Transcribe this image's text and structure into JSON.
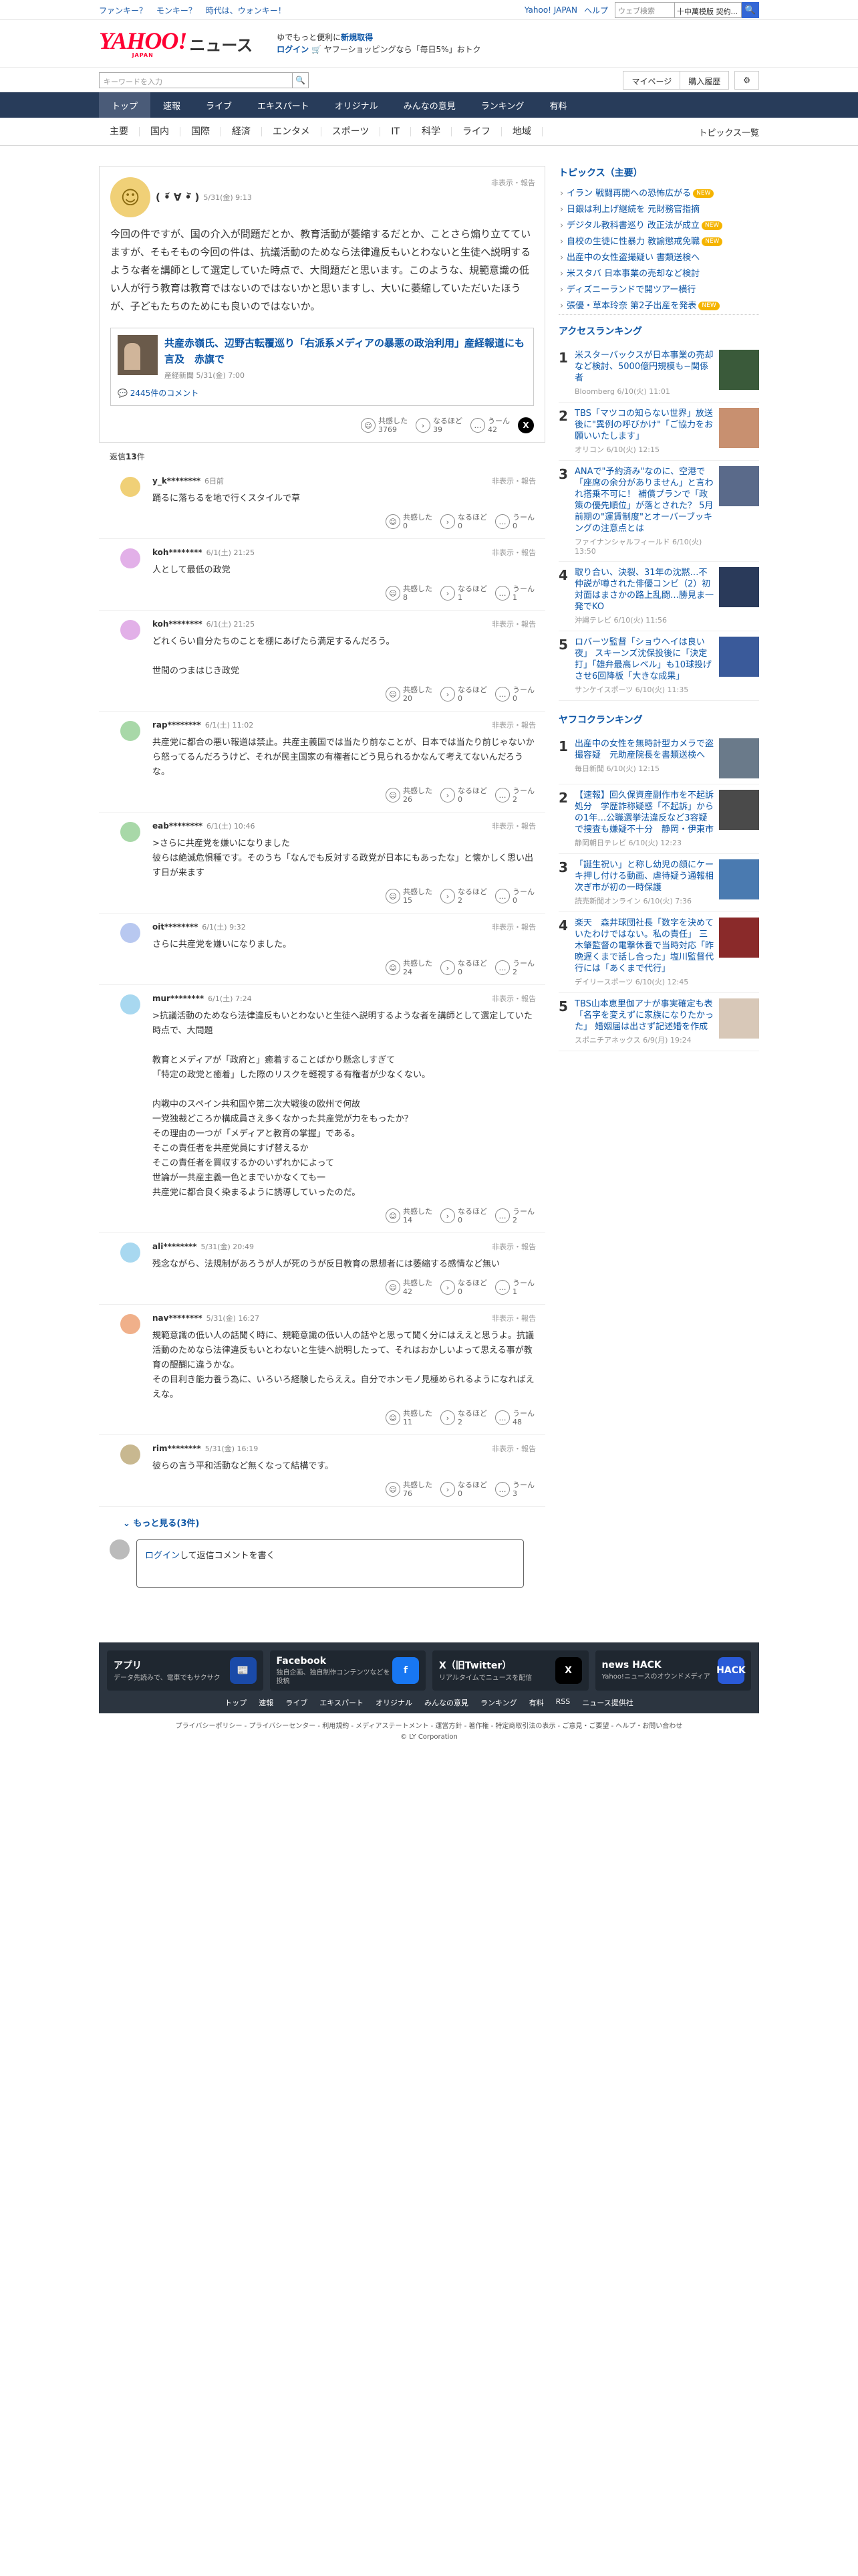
{
  "top": {
    "left_links": [
      "ファンキー？",
      "モンキー？",
      "時代は、ウォンキー！"
    ],
    "right_links": [
      "Yahoo! JAPAN",
      "ヘルプ"
    ],
    "search_placeholder": "ウェブ検索",
    "search_hot": "十中萬模版 契約...",
    "search_btn": "🔍"
  },
  "header": {
    "logo": "YAHOO!",
    "logo_sub": "JAPAN",
    "news": "ニュース",
    "promo_text": "ゆでもっと便利に",
    "promo_strong": "新規取得",
    "promo_login": "ログイン",
    "promo_rest": "🛒 ヤフーショッピングなら「毎日5%」おトク"
  },
  "subhead": {
    "kw_placeholder": "キーワードを入力",
    "kw_btn": "🔍",
    "mypage": "マイページ",
    "history": "購入履歴",
    "gear": "⚙"
  },
  "gnav": [
    "トップ",
    "速報",
    "ライブ",
    "エキスパート",
    "オリジナル",
    "みんなの意見",
    "ランキング",
    "有料"
  ],
  "cnav": [
    "主要",
    "国内",
    "国際",
    "経済",
    "エンタメ",
    "スポーツ",
    "IT",
    "科学",
    "ライフ",
    "地域"
  ],
  "cnav_right": "トピックス一覧",
  "post": {
    "name": "( •᷄ ∀ •᷅ )",
    "date": "5/31(金) 9:13",
    "hide": "非表示・報告",
    "text": "今回の件ですが、国の介入が問題だとか、教育活動が萎縮するだとか、ことさら煽り立てていますが、そもそもの今回の件は、抗議活動のためなら法律違反もいとわないと生徒へ説明するような者を講師として選定していた時点で、大問題だと思います。このような、規範意識の低い人が行う教育は教育ではないのではないかと思いますし、大いに萎縮していただいたほうが、子どもたちのためにも良いのではないか。",
    "link_title": "共産赤嶺氏、辺野古転覆巡り「右派系メディアの暴悪の政治利用」産経報道にも言及　赤旗で",
    "link_src": "産経新聞 5/31(金) 7:00",
    "comments": "2445件のコメント",
    "r1": "共感した",
    "r1n": "3769",
    "r2": "なるほど",
    "r2n": "39",
    "r3": "うーん",
    "r3n": "42",
    "x": "X"
  },
  "replies_label": "返信",
  "replies_count": "13",
  "replies_unit": "件",
  "replies": [
    {
      "user": "y_k********",
      "date": "6日前",
      "color": "#f0d077",
      "text": "踊るに落ちるを地で行くスタイルで草",
      "a": "0",
      "b": "0",
      "c": "0"
    },
    {
      "user": "koh********",
      "date": "6/1(土) 21:25",
      "color": "#e2b0e8",
      "text": "人として最低の政党",
      "a": "8",
      "b": "1",
      "c": "1"
    },
    {
      "user": "koh********",
      "date": "6/1(土) 21:25",
      "color": "#e2b0e8",
      "text": "どれくらい自分たちのことを棚にあげたら満足するんだろう。\n\n世間のつまはじき政党",
      "a": "20",
      "b": "0",
      "c": "0"
    },
    {
      "user": "rap********",
      "date": "6/1(土) 11:02",
      "color": "#a8d8a8",
      "text": "共産党に都合の悪い報道は禁止。共産主義国では当たり前なことが、日本では当たり前じゃないから怒ってるんだろうけど、それが民主国家の有権者にどう見られるかなんて考えてないんだろうな。",
      "a": "26",
      "b": "0",
      "c": "2"
    },
    {
      "user": "eab********",
      "date": "6/1(土) 10:46",
      "color": "#a8d8a8",
      "text": ">さらに共産党を嫌いになりました\n彼らは絶滅危惧種です。そのうち「なんでも反対する政党が日本にもあったな」と懐かしく思い出す日が来ます",
      "a": "15",
      "b": "2",
      "c": "0"
    },
    {
      "user": "oit********",
      "date": "6/1(土) 9:32",
      "color": "#b8c8f0",
      "text": "さらに共産党を嫌いになりました。",
      "a": "24",
      "b": "0",
      "c": "2"
    },
    {
      "user": "mur********",
      "date": "6/1(土) 7:24",
      "color": "#a8d8f0",
      "text": ">抗議活動のためなら法律違反もいとわないと生徒へ説明するような者を講師として選定していた時点で、大問題\n\n教育とメディアが「政府と」癒着することばかり懸念しすぎて\n「特定の政党と癒着」した際のリスクを軽視する有権者が少なくない。\n\n内戦中のスペイン共和国や第二次大戦後の欧州で何故\n一党独裁どころか構成員さえ多くなかった共産党が力をもったか？\nその理由の一つが「メディアと教育の掌握」である。\nそこの責任者を共産党員にすげ替えるか\nそこの責任者を買収するかのいずれかによって\n世論が一共産主義一色とまでいかなくても一\n共産党に都合良く染まるように誘導していったのだ。",
      "a": "14",
      "b": "0",
      "c": "2"
    },
    {
      "user": "ali********",
      "date": "5/31(金) 20:49",
      "color": "#a8d8f0",
      "text": "残念ながら、法規制があろうが人が死のうが反日教育の思想者には萎縮する感情など無い",
      "a": "42",
      "b": "0",
      "c": "1"
    },
    {
      "user": "nav********",
      "date": "5/31(金) 16:27",
      "color": "#f0b08a",
      "text": "規範意識の低い人の話聞く時に、規範意識の低い人の話やと思って聞く分にはええと思うよ。抗議活動のためなら法律違反もいとわないと生徒へ説明したって、それはおかしいよって思える事が教育の醍醐に違うかな。\nその目利き能力養う為に、いろいろ経験したらええ。自分でホンモノ見極められるようになればええな。",
      "a": "11",
      "b": "2",
      "c": "48"
    },
    {
      "user": "rim********",
      "date": "5/31(金) 16:19",
      "color": "#c8b890",
      "text": "彼らの言う平和活動など無くなって結構です。",
      "a": "76",
      "b": "0",
      "c": "3"
    }
  ],
  "labels": {
    "r1": "共感した",
    "r2": "なるほど",
    "r3": "うーん",
    "hide": "非表示・報告"
  },
  "more": "もっと見る(3件)",
  "form": {
    "login": "ログイン",
    "rest": "して返信コメントを書く"
  },
  "topics": {
    "title": "トピックス（主要）",
    "items": [
      {
        "t": "イラン 戦闘再開への恐怖広がる",
        "badge": "new"
      },
      {
        "t": "日銀は利上げ継続を 元財務官指摘",
        "badge": ""
      },
      {
        "t": "デジタル教科書巡り 改正法が成立",
        "badge": "new"
      },
      {
        "t": "自校の生徒に性暴力 教諭懲戒免職",
        "badge": "new"
      },
      {
        "t": "出産中の女性盗撮疑い 書類送検へ",
        "badge": ""
      },
      {
        "t": "米スタバ 日本事業の売却など検討",
        "badge": ""
      },
      {
        "t": "ディズニーランドで開ツアー横行",
        "badge": ""
      },
      {
        "t": "張優・草本玲奈 第2子出産を発表",
        "badge": "new"
      }
    ]
  },
  "access": {
    "title": "アクセスランキング",
    "items": [
      {
        "no": "1",
        "t": "米スターバックスが日本事業の売却など検討、5000億円規模も−関係者",
        "s": "Bloomberg 6/10(火) 11:01",
        "c": "#3a5a3a"
      },
      {
        "no": "2",
        "t": "TBS「マツコの知らない世界」放送後に\"異例の呼びかけ\"「ご協力をお願いいたします」",
        "s": "オリコン 6/10(火) 12:15",
        "c": "#c89070"
      },
      {
        "no": "3",
        "t": "ANAで\"予約済み\"なのに、空港で「座席の余分がありません」と言われ搭乗不可に！ 補償プランで「政策の優先順位」が落とされた？ 5月前期の\"運賃制度\"とオーバーブッキングの注意点とは",
        "s": "ファイナンシャルフィールド 6/10(火) 13:50",
        "c": "#5a6a8a"
      },
      {
        "no": "4",
        "t": "取り合い、決裂、31年の沈黙…不仲説が噂された俳優コンビ（2）初対面はまさかの路上乱闘…勝見ま一発でKO",
        "s": "沖縄テレビ 6/10(火) 11:56",
        "c": "#2a3a5a"
      },
      {
        "no": "5",
        "t": "ロバーツ監督「ショウヘイは良い夜」 スキーンズ沈保投後に「決定打」「雄弁最高レベル」も10球投げさせ6回降板「大きな成果」",
        "s": "サンケイスポーツ 6/10(火) 11:35",
        "c": "#3a5a9a"
      }
    ]
  },
  "yahoo_rank": {
    "title": "ヤフコクランキング",
    "items": [
      {
        "no": "1",
        "t": "出産中の女性を無時計型カメラで盗撮容疑　元助産院長を書類送検へ",
        "s": "毎日新聞 6/10(火) 12:15",
        "c": "#6a7a8a"
      },
      {
        "no": "2",
        "t": "【速報】回久保資産副作市を不起訴処分　学歴詐称疑惑「不起訴」からの1年…公職選挙法違反など3容疑で捜査も嫌疑不十分　静岡・伊東市",
        "s": "静岡朝日テレビ 6/10(火) 12:23",
        "c": "#4a4a4a"
      },
      {
        "no": "3",
        "t": "「誕生祝い」と称し幼児の顔にケーキ押し付ける動画、虐待疑う通報相次ぎ市が初の一時保護",
        "s": "読売新聞オンライン 6/10(火) 7:36",
        "c": "#4a7ab0"
      },
      {
        "no": "4",
        "t": "楽天　森井球団社長「数字を決めていたわけではない。私の責任」 三木肇監督の電撃休養で当時対応「昨晩遅くまで話し合った」塩川監督代行には「あくまで代行」",
        "s": "デイリースポーツ 6/10(火) 12:45",
        "c": "#8a2a2a"
      },
      {
        "no": "5",
        "t": "TBS山本恵里伽アナが事実確定も表「名字を変えずに家族になりたかった」 婚姻届は出さず記述婚を作成",
        "s": "スポニチアネックス 6/9(月) 19:24",
        "c": "#d8c8b8"
      }
    ]
  },
  "footer": {
    "apps": [
      {
        "n": "アプリ",
        "d": "データ先読みで、電車でもサクサク",
        "ic": "📰",
        "c": "#1a4aa8"
      },
      {
        "n": "Facebook",
        "d": "独自企画、独自制作コンテンツなどを投稿",
        "ic": "f",
        "c": "#1877f2"
      },
      {
        "n": "X（旧Twitter）",
        "d": "リアルタイムでニュースを配信",
        "ic": "X",
        "c": "#000000"
      },
      {
        "n": "news HACK",
        "d": "Yahoo!ニュースのオウンドメディア",
        "ic": "HACK",
        "c": "#2a5ad8"
      }
    ],
    "links": [
      "トップ",
      "速報",
      "ライブ",
      "エキスパート",
      "オリジナル",
      "みんなの意見",
      "ランキング",
      "有料",
      "RSS",
      "ニュース提供社"
    ],
    "legal": "プライバシーポリシー - プライバシーセンター - 利用規約 - メディアステートメント - 運営方針 - 著作権 - 特定商取引法の表示 - ご意見・ご要望 - ヘルプ・お問い合わせ",
    "copy": "© LY Corporation"
  }
}
